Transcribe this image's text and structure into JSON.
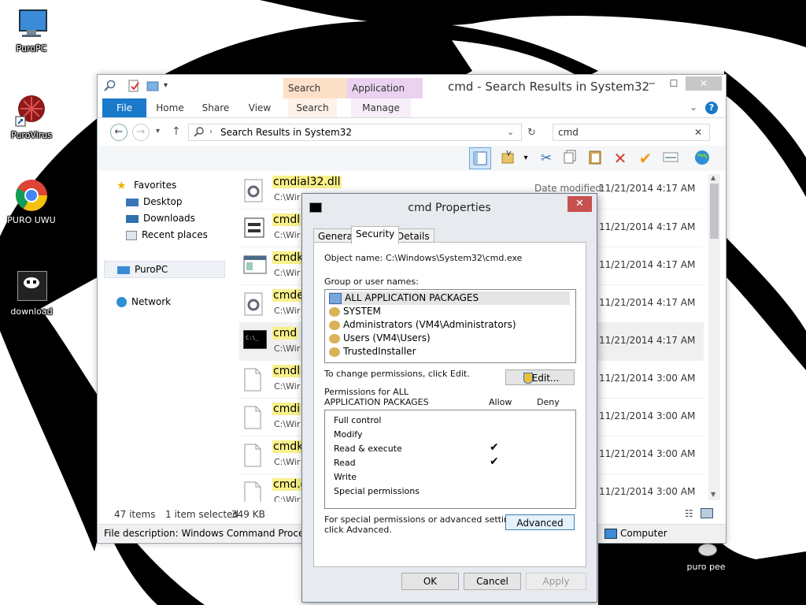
{
  "desktop": {
    "icons": [
      {
        "label": "PuroPC",
        "icon": "computer-icon"
      },
      {
        "label": "PuroVirus",
        "icon": "virus-shortcut-icon"
      },
      {
        "label": "PURO UWU",
        "icon": "chrome-icon"
      },
      {
        "label": "download",
        "icon": "image-icon"
      },
      {
        "label": "puro pee",
        "icon": "recycle-bin-icon"
      }
    ]
  },
  "explorer": {
    "title": "cmd - Search Results in System32",
    "context_tabs": {
      "search_tools": "Search Tools",
      "application_tools": "Application Tools"
    },
    "ribbon_tabs": [
      "File",
      "Home",
      "Share",
      "View",
      "Search",
      "Manage"
    ],
    "address": "Search Results in System32",
    "search_value": "cmd",
    "nav": {
      "favorites": "Favorites",
      "desktop": "Desktop",
      "downloads": "Downloads",
      "recent": "Recent places",
      "pc": "PuroPC",
      "network": "Network"
    },
    "date_label": "Date modified:",
    "files": [
      {
        "name": "cmdial32.dll",
        "path": "C:\\Wir",
        "date": "11/21/2014 4:17 AM",
        "kind": "dll"
      },
      {
        "name": "cmdl",
        "path": "C:\\Wir",
        "date": "11/21/2014 4:17 AM",
        "kind": "mgr"
      },
      {
        "name": "cmdk",
        "path": "C:\\Wir",
        "date": "11/21/2014 4:17 AM",
        "kind": "app"
      },
      {
        "name": "cmde",
        "path": "C:\\Wir",
        "date": "11/21/2014 4:17 AM",
        "kind": "dll"
      },
      {
        "name": "cmd",
        "path": "C:\\Wir",
        "date": "11/21/2014 4:17 AM",
        "kind": "console"
      },
      {
        "name": "cmdl",
        "path": "C:\\Wir",
        "date": "11/21/2014 3:00 AM",
        "kind": "file"
      },
      {
        "name": "cmdi",
        "path": "C:\\Wir",
        "date": "11/21/2014 3:00 AM",
        "kind": "file"
      },
      {
        "name": "cmdk",
        "path": "C:\\Wir",
        "date": "11/21/2014 3:00 AM",
        "kind": "file"
      },
      {
        "name": "cmd.e",
        "path": "C:\\Wir",
        "date": "11/21/2014 3:00 AM",
        "kind": "file"
      }
    ],
    "status": {
      "items": "47 items",
      "selected": "1 item selected",
      "size": "349 KB"
    },
    "file_description": "File description: Windows Command Processor,",
    "computer": "Computer"
  },
  "dialog": {
    "title": "cmd Properties",
    "tabs": [
      "General",
      "Security",
      "Details"
    ],
    "object_label": "Object name:",
    "object_value": "C:\\Windows\\System32\\cmd.exe",
    "group_label": "Group or user names:",
    "groups": [
      "ALL APPLICATION PACKAGES",
      "SYSTEM",
      "Administrators (VM4\\Administrators)",
      "Users (VM4\\Users)",
      "TrustedInstaller"
    ],
    "change_text": "To change permissions, click Edit.",
    "edit_button": "Edit...",
    "perm_label_1": "Permissions for ALL",
    "perm_label_2": "APPLICATION PACKAGES",
    "allow": "Allow",
    "deny": "Deny",
    "permissions": [
      {
        "name": "Full control",
        "allow": false
      },
      {
        "name": "Modify",
        "allow": false
      },
      {
        "name": "Read & execute",
        "allow": true
      },
      {
        "name": "Read",
        "allow": true
      },
      {
        "name": "Write",
        "allow": false
      },
      {
        "name": "Special permissions",
        "allow": false
      }
    ],
    "special_1": "For special permissions or advanced settings,",
    "special_2": "click Advanced.",
    "advanced_button": "Advanced",
    "ok": "OK",
    "cancel": "Cancel",
    "apply": "Apply"
  }
}
